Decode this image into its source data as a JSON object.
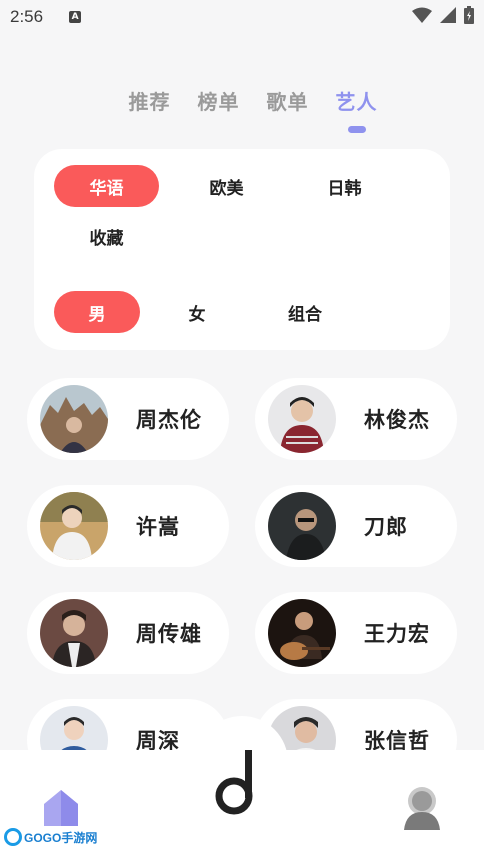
{
  "status_bar": {
    "time": "2:56",
    "notification_letter": "A"
  },
  "tabs": [
    {
      "label": "推荐",
      "active": false
    },
    {
      "label": "榜单",
      "active": false
    },
    {
      "label": "歌单",
      "active": false
    },
    {
      "label": "艺人",
      "active": true
    }
  ],
  "filters": {
    "regions": [
      {
        "label": "华语",
        "active": true
      },
      {
        "label": "欧美",
        "active": false
      },
      {
        "label": "日韩",
        "active": false
      },
      {
        "label": "收藏",
        "active": false
      }
    ],
    "genders": [
      {
        "label": "男",
        "active": true
      },
      {
        "label": "女",
        "active": false
      },
      {
        "label": "组合",
        "active": false
      }
    ]
  },
  "artists": [
    {
      "name": "周杰伦"
    },
    {
      "name": "林俊杰"
    },
    {
      "name": "许嵩"
    },
    {
      "name": "刀郎"
    },
    {
      "name": "周传雄"
    },
    {
      "name": "王力宏"
    },
    {
      "name": "周深"
    },
    {
      "name": "张信哲"
    }
  ],
  "watermark": {
    "text": "GOGO手游网",
    "url": "WWW.GOGO8.CN"
  },
  "colors": {
    "accent": "#8f92ee",
    "chip_active": "#fa5a5a",
    "background": "#f6f6f7"
  }
}
